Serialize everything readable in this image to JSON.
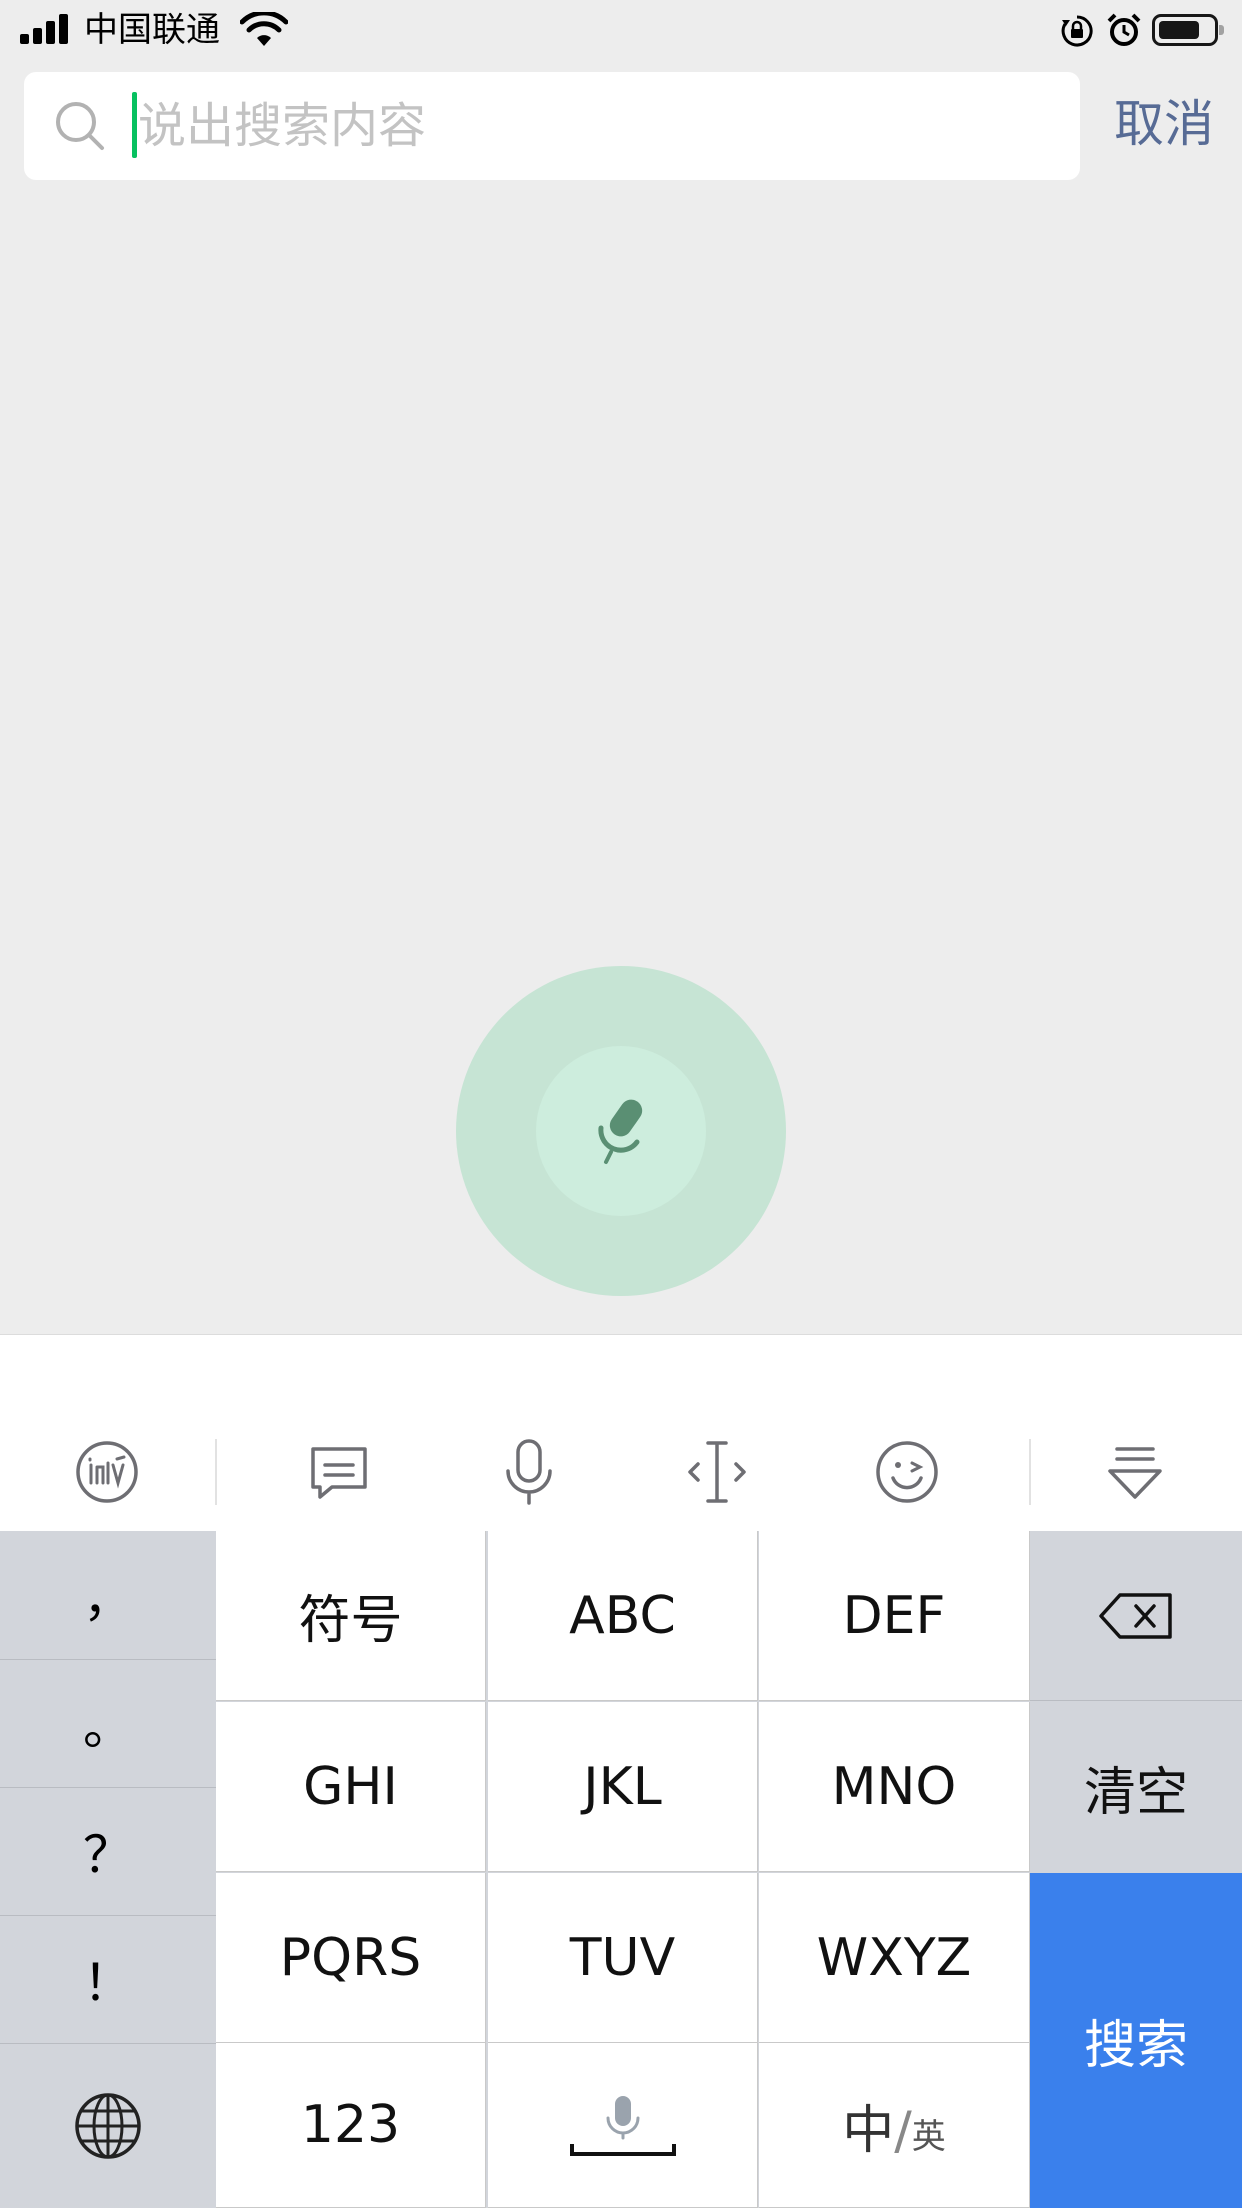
{
  "status_bar": {
    "carrier": "中国联通"
  },
  "search": {
    "placeholder": "说出搜索内容",
    "cancel_label": "取消"
  },
  "keyboard": {
    "punctuation": [
      "，",
      "。",
      "？",
      "！"
    ],
    "keys_row1": [
      "符号",
      "ABC",
      "DEF"
    ],
    "keys_row2": [
      "GHI",
      "JKL",
      "MNO"
    ],
    "keys_row3": [
      "PQRS",
      "TUV",
      "WXYZ"
    ],
    "number_key": "123",
    "lang_key_main": "中",
    "lang_key_sub": "英",
    "clear_label": "清空",
    "search_label": "搜索"
  },
  "colors": {
    "accent_green": "#07c160",
    "link_blue": "#576b95",
    "search_key_blue": "#3a80ec"
  }
}
